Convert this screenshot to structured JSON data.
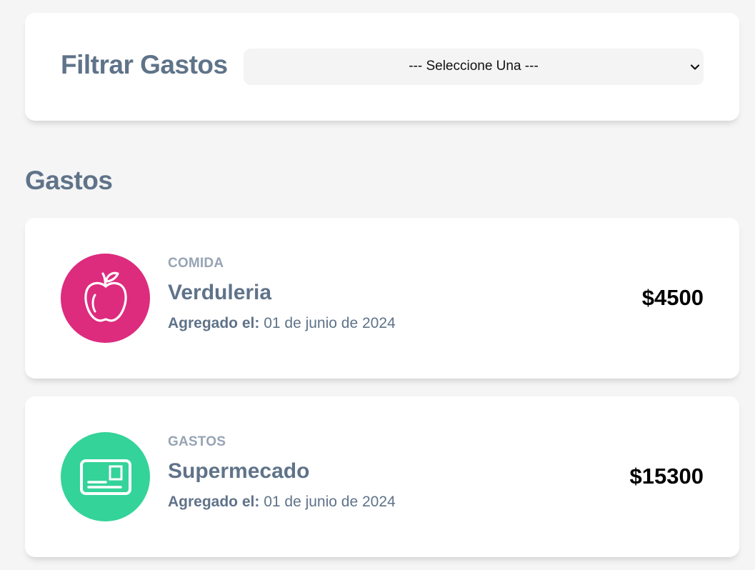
{
  "filter": {
    "title": "Filtrar Gastos",
    "selected": "--- Seleccione Una ---"
  },
  "section": {
    "title": "Gastos"
  },
  "expenses": [
    {
      "category": "COMIDA",
      "name": "Verduleria",
      "date_label": "Agregado el:",
      "date": "01 de junio de 2024",
      "amount": "$4500",
      "icon": "apple-icon",
      "color": "#dd2b7e"
    },
    {
      "category": "GASTOS",
      "name": "Supermecado",
      "date_label": "Agregado el:",
      "date": "01 de junio de 2024",
      "amount": "$15300",
      "icon": "card-icon",
      "color": "#34d399"
    }
  ]
}
